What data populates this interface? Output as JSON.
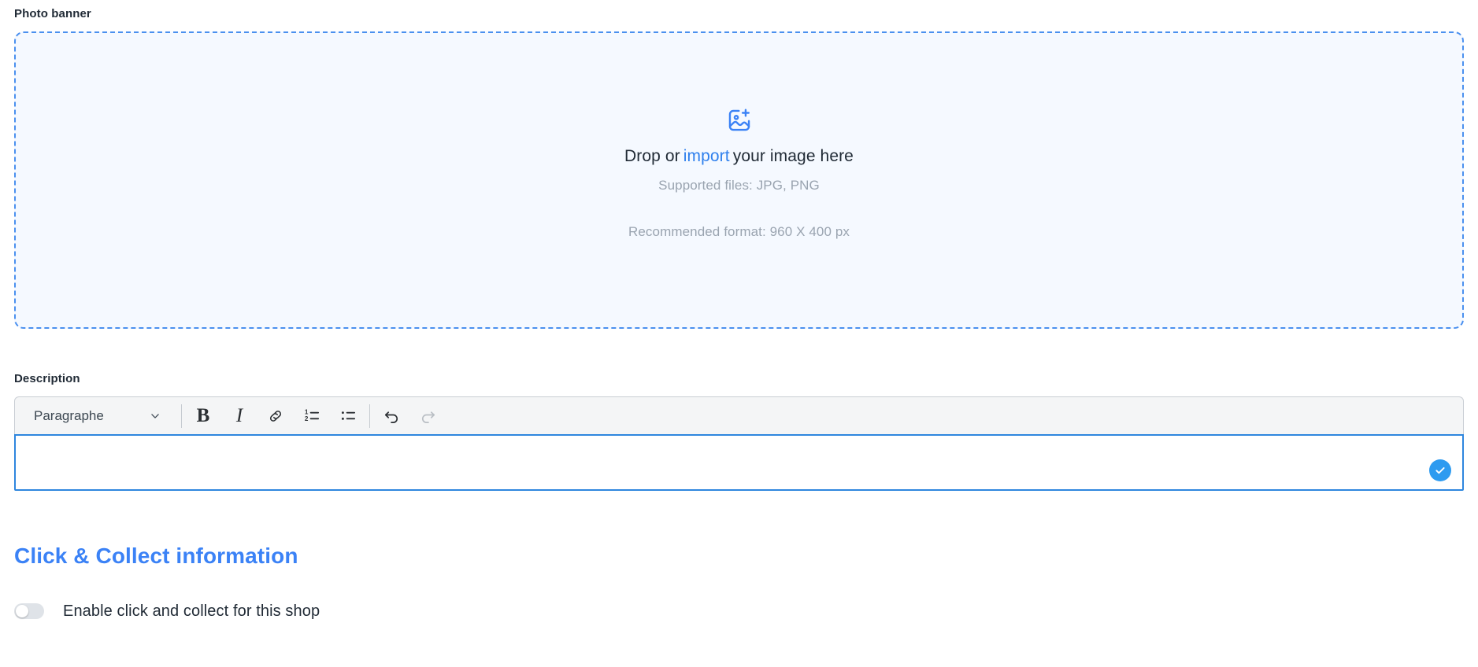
{
  "photo_banner": {
    "label": "Photo banner",
    "dropzone": {
      "icon": "image-plus-icon",
      "drop_prefix": "Drop or",
      "import_link": "import",
      "drop_suffix": "your image here",
      "supported_files": "Supported files: JPG, PNG",
      "recommended_format": "Recommended format: 960 X 400 px"
    }
  },
  "description": {
    "label": "Description",
    "toolbar": {
      "block_format": "Paragraphe",
      "chevron_icon": "chevron-down-icon",
      "bold_label": "B",
      "italic_label": "I",
      "link_icon": "link-icon",
      "ordered_list_icon": "ordered-list-icon",
      "bullet_list_icon": "bullet-list-icon",
      "undo_icon": "undo-icon",
      "redo_icon": "redo-icon",
      "ordered_first": "1",
      "ordered_second": "2"
    },
    "editor": {
      "value": "",
      "placeholder": "",
      "confirm_icon": "check-icon"
    }
  },
  "click_collect": {
    "heading": "Click & Collect information",
    "toggle": {
      "label": "Enable click and collect for this shop",
      "enabled": false
    }
  },
  "colors": {
    "accent_blue": "#3b82f6",
    "link_blue": "#2f80ed",
    "dropzone_bg": "#f5f9ff",
    "toolbar_bg": "#f4f5f6",
    "muted_text": "#9aa4b0",
    "focus_border": "#2e86de",
    "confirm_blue": "#2e9bf0"
  }
}
